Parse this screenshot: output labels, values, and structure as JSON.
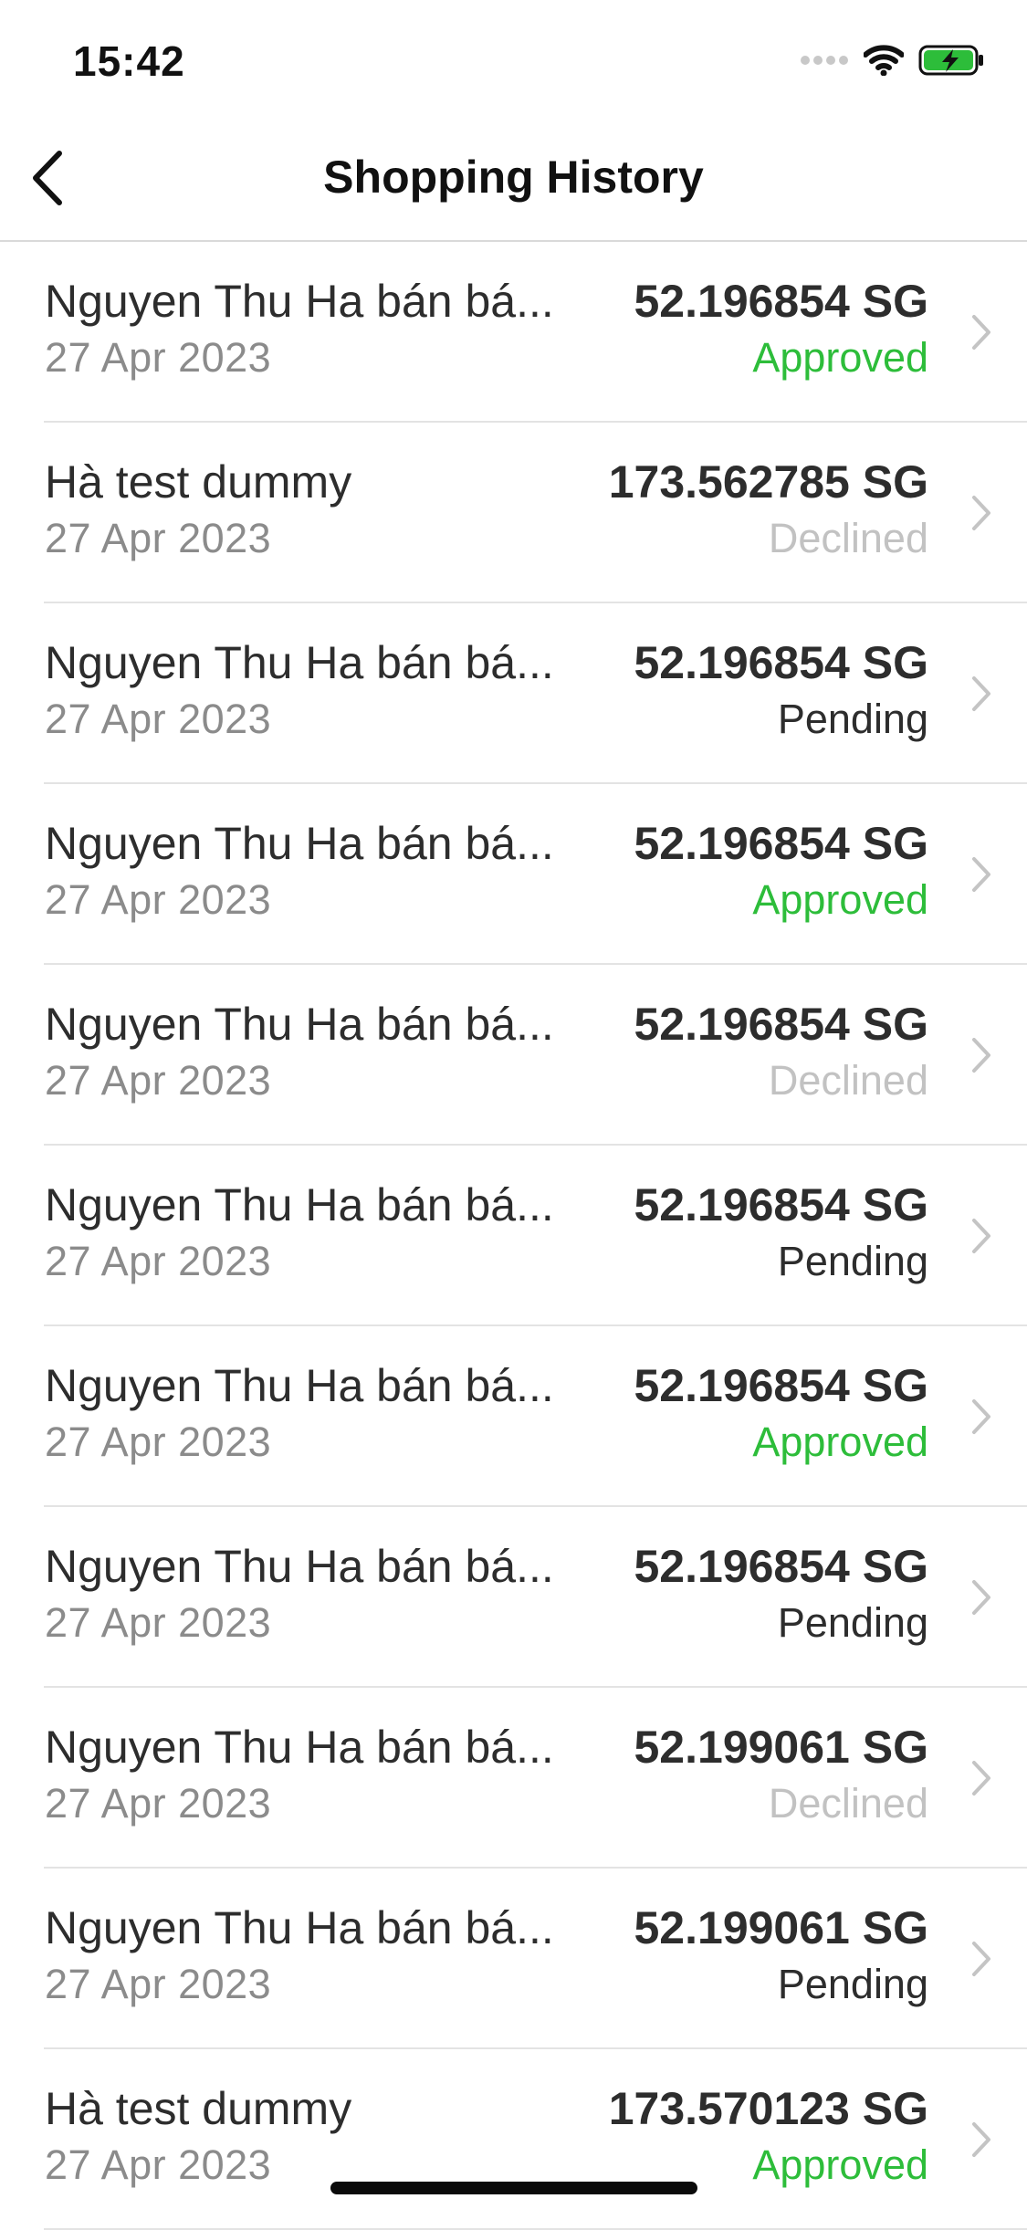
{
  "status_bar": {
    "time": "15:42",
    "icons": [
      "signal-icon",
      "wifi-icon",
      "battery-charging-icon"
    ],
    "battery_color": "#2dbd3a"
  },
  "header": {
    "title": "Shopping History",
    "back_icon": "chevron-left-icon"
  },
  "status_colors": {
    "Approved": "#2dbd3a",
    "Declined": "#c2c2c2",
    "Pending": "#2d2d2d"
  },
  "transactions": [
    {
      "title": "Nguyen Thu Ha bán bá...",
      "date": "27 Apr 2023",
      "amount": "52.196854 SG",
      "status": "Approved"
    },
    {
      "title": "Hà test dummy",
      "date": "27 Apr 2023",
      "amount": "173.562785 SG",
      "status": "Declined"
    },
    {
      "title": "Nguyen Thu Ha bán bá...",
      "date": "27 Apr 2023",
      "amount": "52.196854 SG",
      "status": "Pending"
    },
    {
      "title": "Nguyen Thu Ha bán bá...",
      "date": "27 Apr 2023",
      "amount": "52.196854 SG",
      "status": "Approved"
    },
    {
      "title": "Nguyen Thu Ha bán bá...",
      "date": "27 Apr 2023",
      "amount": "52.196854 SG",
      "status": "Declined"
    },
    {
      "title": "Nguyen Thu Ha bán bá...",
      "date": "27 Apr 2023",
      "amount": "52.196854 SG",
      "status": "Pending"
    },
    {
      "title": "Nguyen Thu Ha bán bá...",
      "date": "27 Apr 2023",
      "amount": "52.196854 SG",
      "status": "Approved"
    },
    {
      "title": "Nguyen Thu Ha bán bá...",
      "date": "27 Apr 2023",
      "amount": "52.196854 SG",
      "status": "Pending"
    },
    {
      "title": "Nguyen Thu Ha bán bá...",
      "date": "27 Apr 2023",
      "amount": "52.199061 SG",
      "status": "Declined"
    },
    {
      "title": "Nguyen Thu Ha bán bá...",
      "date": "27 Apr 2023",
      "amount": "52.199061 SG",
      "status": "Pending"
    },
    {
      "title": "Hà test dummy",
      "date": "27 Apr 2023",
      "amount": "173.570123 SG",
      "status": "Approved"
    }
  ]
}
